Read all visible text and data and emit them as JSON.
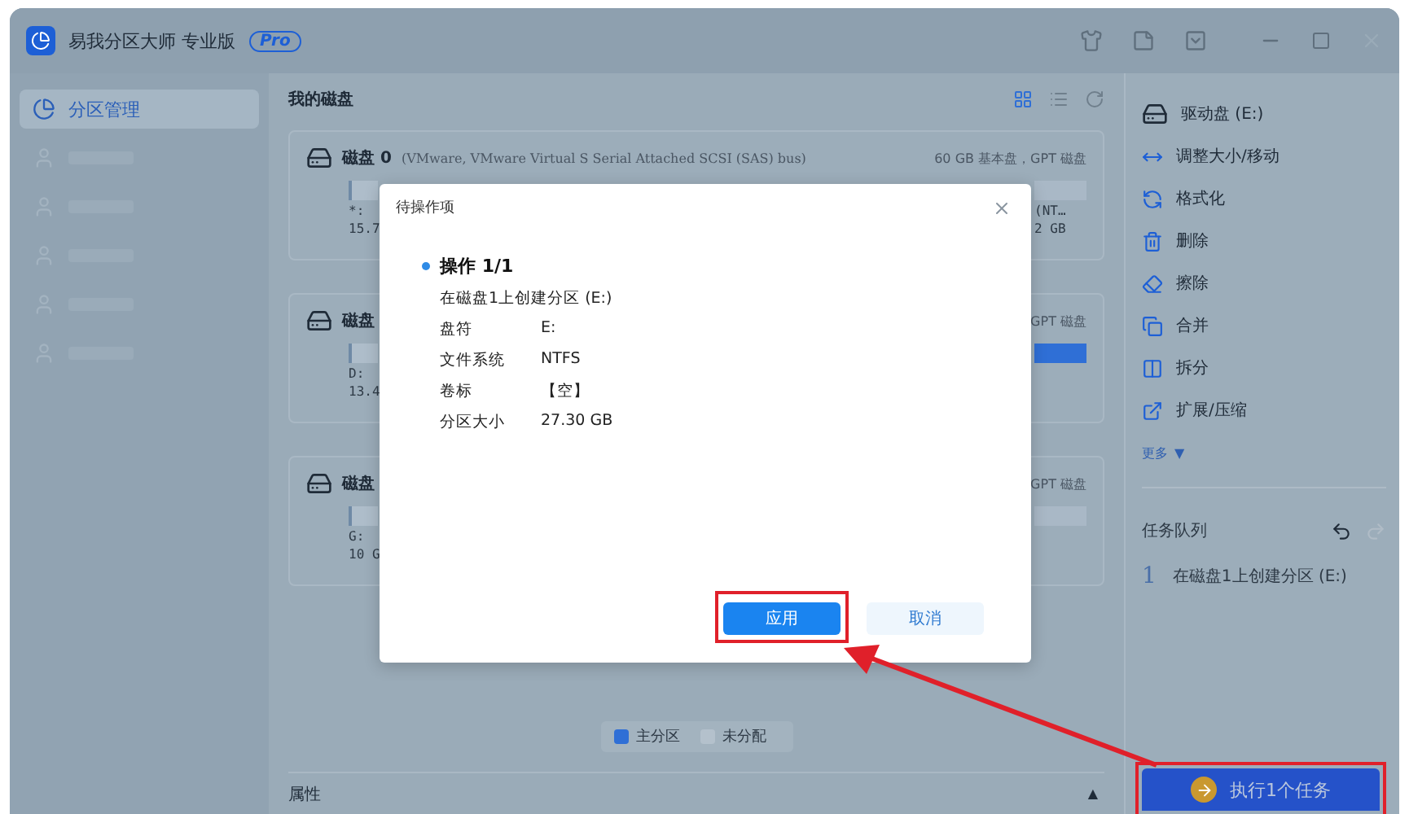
{
  "window": {
    "title": "易我分区大师 专业版",
    "badge": "Pro"
  },
  "sidebar": {
    "items": [
      {
        "label": "分区管理",
        "selected": true
      },
      {
        "selected": false
      },
      {
        "selected": false
      },
      {
        "selected": false
      },
      {
        "selected": false
      },
      {
        "selected": false
      }
    ]
  },
  "main": {
    "title": "我的磁盘",
    "view_modes": [
      {
        "selected": true
      },
      {
        "selected": false
      }
    ],
    "disks": [
      {
        "name": "磁盘",
        "number": "0",
        "info": "(VMware,  VMware Virtual S Serial Attached SCSI (SAS) bus)",
        "summary": "60 GB 基本盘，GPT 磁盘",
        "left_text": [
          "*:",
          "15.7"
        ],
        "right_text": [
          "(NT…",
          "2 GB"
        ],
        "right_segment": {
          "color": "#a9b8c6"
        }
      },
      {
        "name": "磁盘",
        "summary": "GPT 磁盘",
        "left_text": [
          "D:",
          "13.4"
        ],
        "right_segment": {
          "color": "#2f6fd6"
        }
      },
      {
        "name": "磁盘",
        "summary": "GPT 磁盘",
        "left_text": [
          "G:",
          "10 G"
        ],
        "right_segment": {
          "color": "#a9b8c6"
        }
      }
    ],
    "legend": [
      {
        "label": "主分区",
        "color": "#2f6fd6"
      },
      {
        "label": "未分配",
        "color": "#b4c1cc"
      }
    ],
    "properties": {
      "label": "属性",
      "toggle": "▲"
    }
  },
  "dialog": {
    "title": "待操作项",
    "operation": {
      "title": "操作",
      "count": "1/1",
      "description": "在磁盘1上创建分区 (E:)",
      "fields": [
        {
          "label": "盘符",
          "value": "E:"
        },
        {
          "label": "文件系统",
          "value": "NTFS"
        },
        {
          "label": "卷标",
          "value": "【空】"
        },
        {
          "label": "分区大小",
          "value": "27.30 GB"
        }
      ]
    },
    "buttons": [
      {
        "label": "应用",
        "kind": "primary",
        "highlighted": true
      },
      {
        "label": "取消",
        "kind": "secondary",
        "highlighted": false
      }
    ]
  },
  "right_panel": {
    "drive": "驱动盘 (E:)",
    "actions": [
      {
        "label": "调整大小/移动",
        "kind": "resize"
      },
      {
        "label": "格式化",
        "kind": "format"
      },
      {
        "label": "删除",
        "kind": "delete"
      },
      {
        "label": "擦除",
        "kind": "wipe"
      },
      {
        "label": "合并",
        "kind": "merge"
      },
      {
        "label": "拆分",
        "kind": "split"
      },
      {
        "label": "扩展/压缩",
        "kind": "extend"
      }
    ],
    "more": "更多",
    "more_arrow": "▼",
    "task_queue": {
      "title": "任务队列",
      "tasks": [
        {
          "number": "1",
          "label": "在磁盘1上创建分区 (E:)"
        }
      ]
    },
    "execute_button": {
      "label": "执行1个任务",
      "highlighted": true
    }
  }
}
